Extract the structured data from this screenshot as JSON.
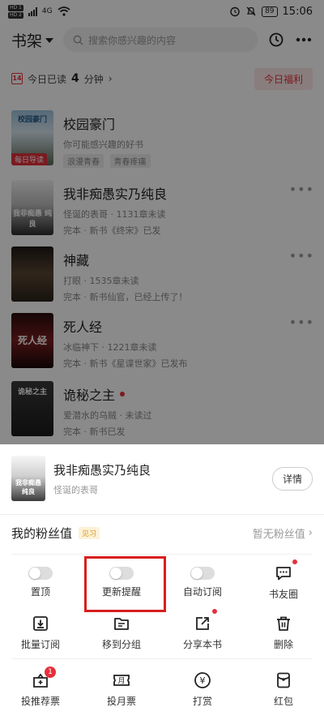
{
  "status_bar": {
    "sim1": "HD 1",
    "sim2": "HD 2",
    "network": "4G",
    "battery": "89",
    "time": "15:06"
  },
  "header": {
    "title": "书架",
    "search_placeholder": "搜索你感兴趣的内容",
    "icons": [
      "history-icon",
      "more-icon"
    ]
  },
  "read_bar": {
    "prefix": "今日已读",
    "minutes": "4",
    "suffix": "分钟",
    "arrow": "›",
    "calendar_day": "14",
    "welfare_label": "今日福利"
  },
  "books": [
    {
      "title": "校园豪门",
      "line1": "你可能感兴趣的好书",
      "tags": [
        "浪漫青春",
        "青春疼痛"
      ],
      "daily_tag": "每日导读",
      "cover_text": "校园豪门",
      "cover_color": "#7aa8c9"
    },
    {
      "title": "我非痴愚实乃纯良",
      "line1": "怪诞的表哥 · 1131章未读",
      "line2": "完本 · 新书《终宋》已发",
      "cover_text": "我非痴愚 纯良",
      "cover_color": "#4a4a4a"
    },
    {
      "title": "神藏",
      "line1": "打眼 · 1535章未读",
      "line2": "完本 · 新书仙官，已经上传了！",
      "cover_text": "",
      "cover_color": "#3b2f24"
    },
    {
      "title": "死人经",
      "line1": "冰临神下 · 1221章未读",
      "line2": "完本 · 新书《星谍世家》已发布",
      "cover_text": "死人经",
      "cover_color": "#5a1818"
    },
    {
      "title": "诡秘之主",
      "line1": "爱潜水的乌贼 · 未读过",
      "line2": "完本 · 新书已发",
      "cover_text": "诡秘之主",
      "cover_color": "#2a2a2a",
      "has_dot": true
    }
  ],
  "sheet": {
    "book_title": "我非痴愚实乃纯良",
    "author": "怪诞的表哥",
    "detail_label": "详情",
    "cover_text": "我非痴愚 纯良",
    "fans_label": "我的粉丝值",
    "fans_badge": "见习",
    "fans_value": "暂无粉丝值",
    "fans_arrow": "›",
    "row1": [
      {
        "label": "置顶",
        "icon": "toggle"
      },
      {
        "label": "更新提醒",
        "icon": "toggle"
      },
      {
        "label": "自动订阅",
        "icon": "toggle"
      },
      {
        "label": "书友圈",
        "icon": "chat-icon"
      }
    ],
    "row2": [
      {
        "label": "批量订阅",
        "icon": "download-icon"
      },
      {
        "label": "移到分组",
        "icon": "folder-icon"
      },
      {
        "label": "分享本书",
        "icon": "share-icon"
      },
      {
        "label": "删除",
        "icon": "trash-icon"
      }
    ],
    "row3": [
      {
        "label": "投推荐票",
        "icon": "recommend-ticket-icon",
        "badge": "1"
      },
      {
        "label": "投月票",
        "icon": "month-ticket-icon",
        "glyph": "月"
      },
      {
        "label": "打赏",
        "icon": "reward-icon",
        "glyph": "¥"
      },
      {
        "label": "红包",
        "icon": "red-packet-icon"
      }
    ]
  },
  "colors": {
    "accent_red": "#e4303c",
    "highlight_red": "#d91e1e"
  }
}
